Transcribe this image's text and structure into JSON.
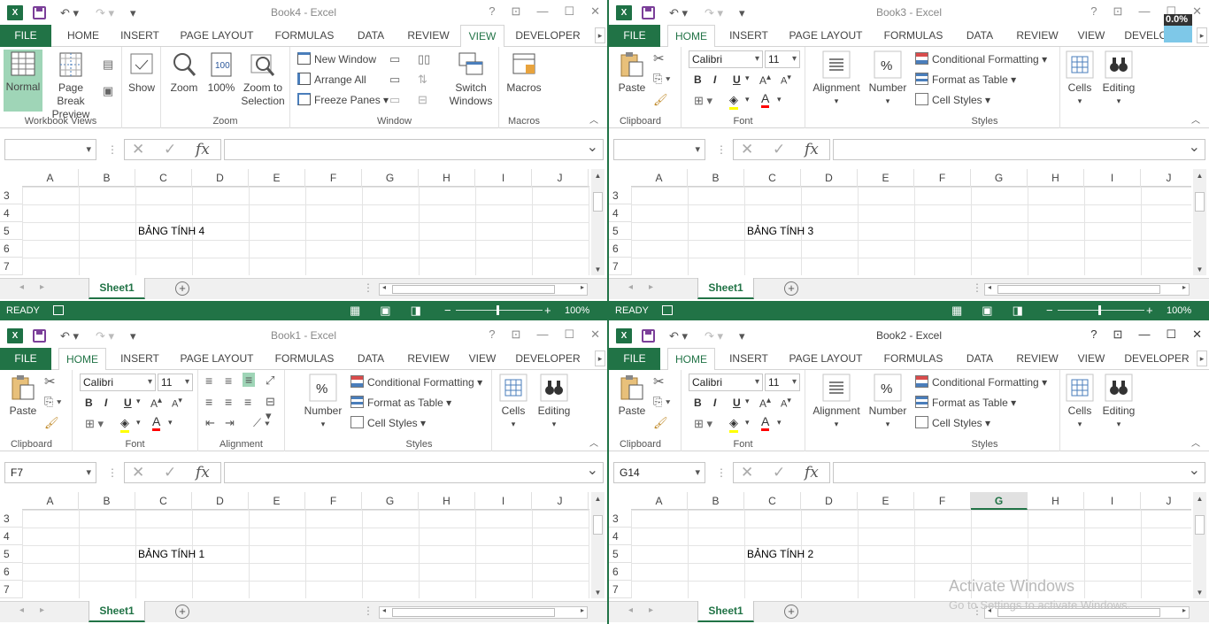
{
  "windows": [
    {
      "id": "book4",
      "title": "Book4 - Excel",
      "active_tab": "VIEW",
      "tabs": [
        "FILE",
        "HOME",
        "INSERT",
        "PAGE LAYOUT",
        "FORMULAS",
        "DATA",
        "REVIEW",
        "VIEW",
        "DEVELOPER"
      ],
      "name_box": "",
      "cell_text": "BẢNG TÍNH 4",
      "sheet": "Sheet1",
      "status": "READY",
      "zoom": "100%",
      "ribbon_view": {
        "normal": "Normal",
        "page_break": "Page Break Preview",
        "show": "Show",
        "zoom": "Zoom",
        "zoom100": "100%",
        "zoom_sel": "Zoom to Selection",
        "new_window": "New Window",
        "arrange_all": "Arrange All",
        "freeze_panes": "Freeze Panes",
        "switch_windows": "Switch Windows",
        "macros": "Macros",
        "grp_workbook_views": "Workbook Views",
        "grp_zoom": "Zoom",
        "grp_window": "Window",
        "grp_macros": "Macros"
      }
    },
    {
      "id": "book3",
      "title": "Book3 - Excel",
      "active_tab": "HOME",
      "name_box": "",
      "cell_text": "BẢNG TÍNH 3",
      "sheet": "Sheet1",
      "status": "READY",
      "zoom": "100%"
    },
    {
      "id": "book1",
      "title": "Book1 - Excel",
      "active_tab": "HOME",
      "name_box": "F7",
      "cell_text": "BẢNG TÍNH 1",
      "sheet": "Sheet1"
    },
    {
      "id": "book2",
      "title": "Book2 - Excel",
      "active_tab": "HOME",
      "name_box": "G14",
      "cell_text": "BẢNG TÍNH 2",
      "sheet": "Sheet1"
    }
  ],
  "home_ribbon": {
    "paste": "Paste",
    "font_name": "Calibri",
    "font_size": "11",
    "alignment": "Alignment",
    "number": "Number",
    "cond_format": "Conditional Formatting",
    "format_table": "Format as Table",
    "cell_styles": "Cell Styles",
    "cells": "Cells",
    "editing": "Editing",
    "grp_clipboard": "Clipboard",
    "grp_font": "Font",
    "grp_styles": "Styles",
    "grp_alignment": "Alignment",
    "bold": "B",
    "italic": "I",
    "underline": "U"
  },
  "columns": [
    "A",
    "B",
    "C",
    "D",
    "E",
    "F",
    "G",
    "H",
    "I",
    "J"
  ],
  "rows": [
    "3",
    "4",
    "5",
    "6",
    "7"
  ],
  "watermark": {
    "line1": "Activate Windows",
    "line2": "Go to Settings to activate Windows."
  },
  "perf_badge": "0.0%",
  "colors": {
    "excel_green": "#217346",
    "selected_view": "#9fd5b7"
  }
}
